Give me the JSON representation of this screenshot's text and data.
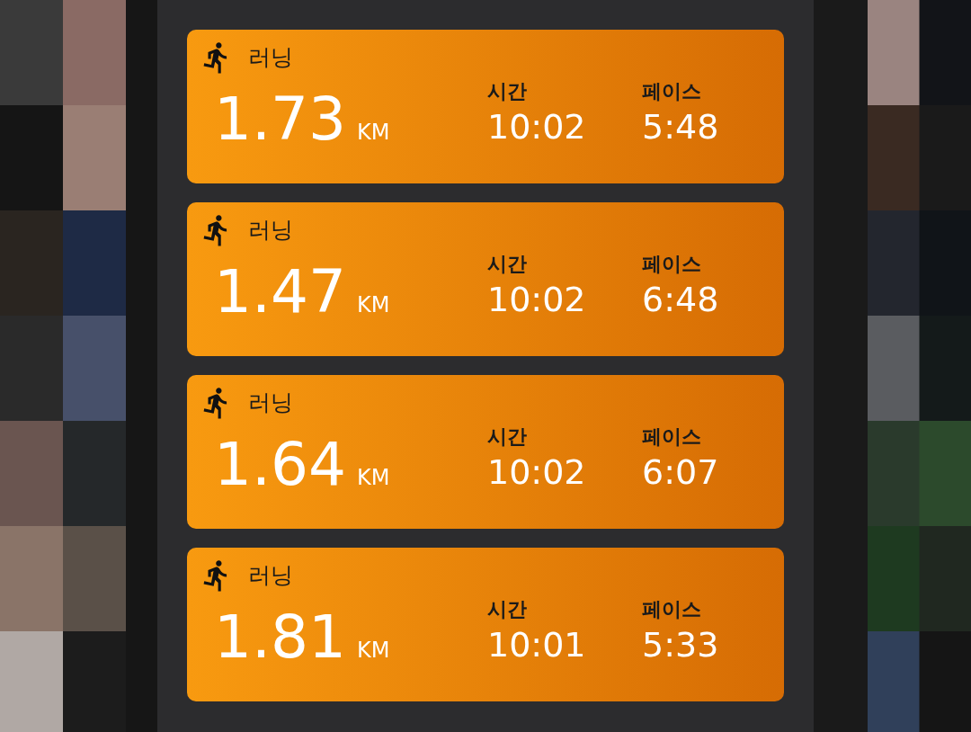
{
  "workouts": [
    {
      "type": "러닝",
      "distance": "1.73",
      "unit": "KM",
      "time_label": "시간",
      "time": "10:02",
      "pace_label": "페이스",
      "pace": "5:48"
    },
    {
      "type": "러닝",
      "distance": "1.47",
      "unit": "KM",
      "time_label": "시간",
      "time": "10:02",
      "pace_label": "페이스",
      "pace": "6:48"
    },
    {
      "type": "러닝",
      "distance": "1.64",
      "unit": "KM",
      "time_label": "시간",
      "time": "10:02",
      "pace_label": "페이스",
      "pace": "6:07"
    },
    {
      "type": "러닝",
      "distance": "1.81",
      "unit": "KM",
      "time_label": "시간",
      "time": "10:01",
      "pace_label": "페이스",
      "pace": "5:33"
    }
  ]
}
